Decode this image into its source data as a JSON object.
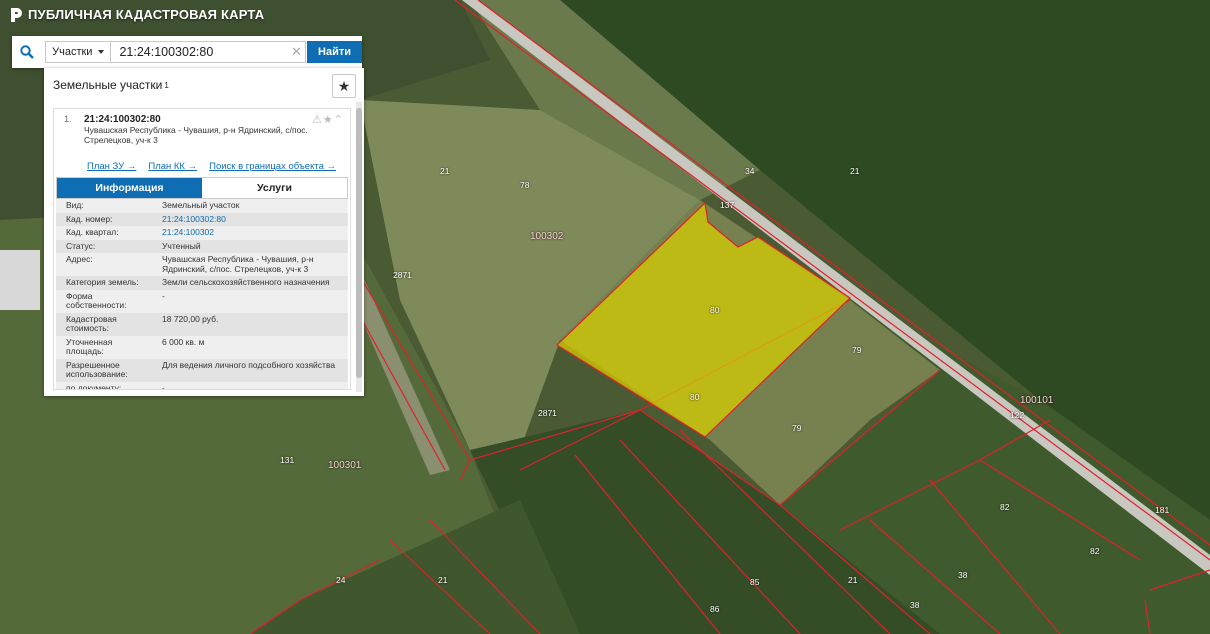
{
  "app": {
    "title": "ПУБЛИЧНАЯ КАДАСТРОВАЯ КАРТА"
  },
  "search": {
    "type_label": "Участки",
    "query": "21:24:100302:80",
    "find_label": "Найти"
  },
  "panel": {
    "title": "Земельные участки",
    "count": "1",
    "item": {
      "index": "1.",
      "cadastral_number": "21:24:100302:80",
      "address": "Чувашская Республика - Чувашия, р-н Ядринский, с/пос. Стрелецков, уч-к 3",
      "links": [
        "План ЗУ →",
        "План КК →",
        "Поиск в границах объекта →"
      ],
      "tabs": {
        "info": "Информация",
        "services": "Услуги"
      },
      "fields": [
        {
          "k": "Вид:",
          "v": "Земельный участок"
        },
        {
          "k": "Кад. номер:",
          "v": "21:24:100302:80"
        },
        {
          "k": "Кад. квартал:",
          "v": "21:24:100302"
        },
        {
          "k": "Статус:",
          "v": "Учтенный"
        },
        {
          "k": "Адрес:",
          "v": "Чувашская Республика - Чувашия, р-н Ядринский, с/пос. Стрелецков, уч-к 3"
        },
        {
          "k": "Категория земель:",
          "v": "Земли сельскохозяйственного назначения"
        },
        {
          "k": "Форма собственности:",
          "v": "-"
        },
        {
          "k": "Кадастровая стоимость:",
          "v": "18 720,00 руб."
        },
        {
          "k": "Уточненная площадь:",
          "v": "6 000 кв. м"
        },
        {
          "k": "Разрешенное использование:",
          "v": "Для ведения личного подсобного хозяйства"
        },
        {
          "k": "по документу:",
          "v": "-"
        }
      ]
    }
  },
  "map_labels": {
    "l21a": "21",
    "l21b": "21",
    "l21c": "21",
    "l21d": "21",
    "l78": "78",
    "l137": "137",
    "l100302": "100302",
    "l2871a": "2871",
    "l2871b": "2871",
    "l80a": "80",
    "l80b": "80",
    "l79a": "79",
    "l79b": "79",
    "l34": "34",
    "l131": "131",
    "l100301": "100301",
    "l181": "181",
    "l82a": "82",
    "l82b": "82",
    "l38a": "38",
    "l38b": "38",
    "l85": "85",
    "l86": "86",
    "l24": "24",
    "l122": "122",
    "l100101": "100101"
  },
  "colors": {
    "accent": "#0f6db3",
    "parcel_fill": "#d8d000",
    "boundary": "#e0202a"
  }
}
